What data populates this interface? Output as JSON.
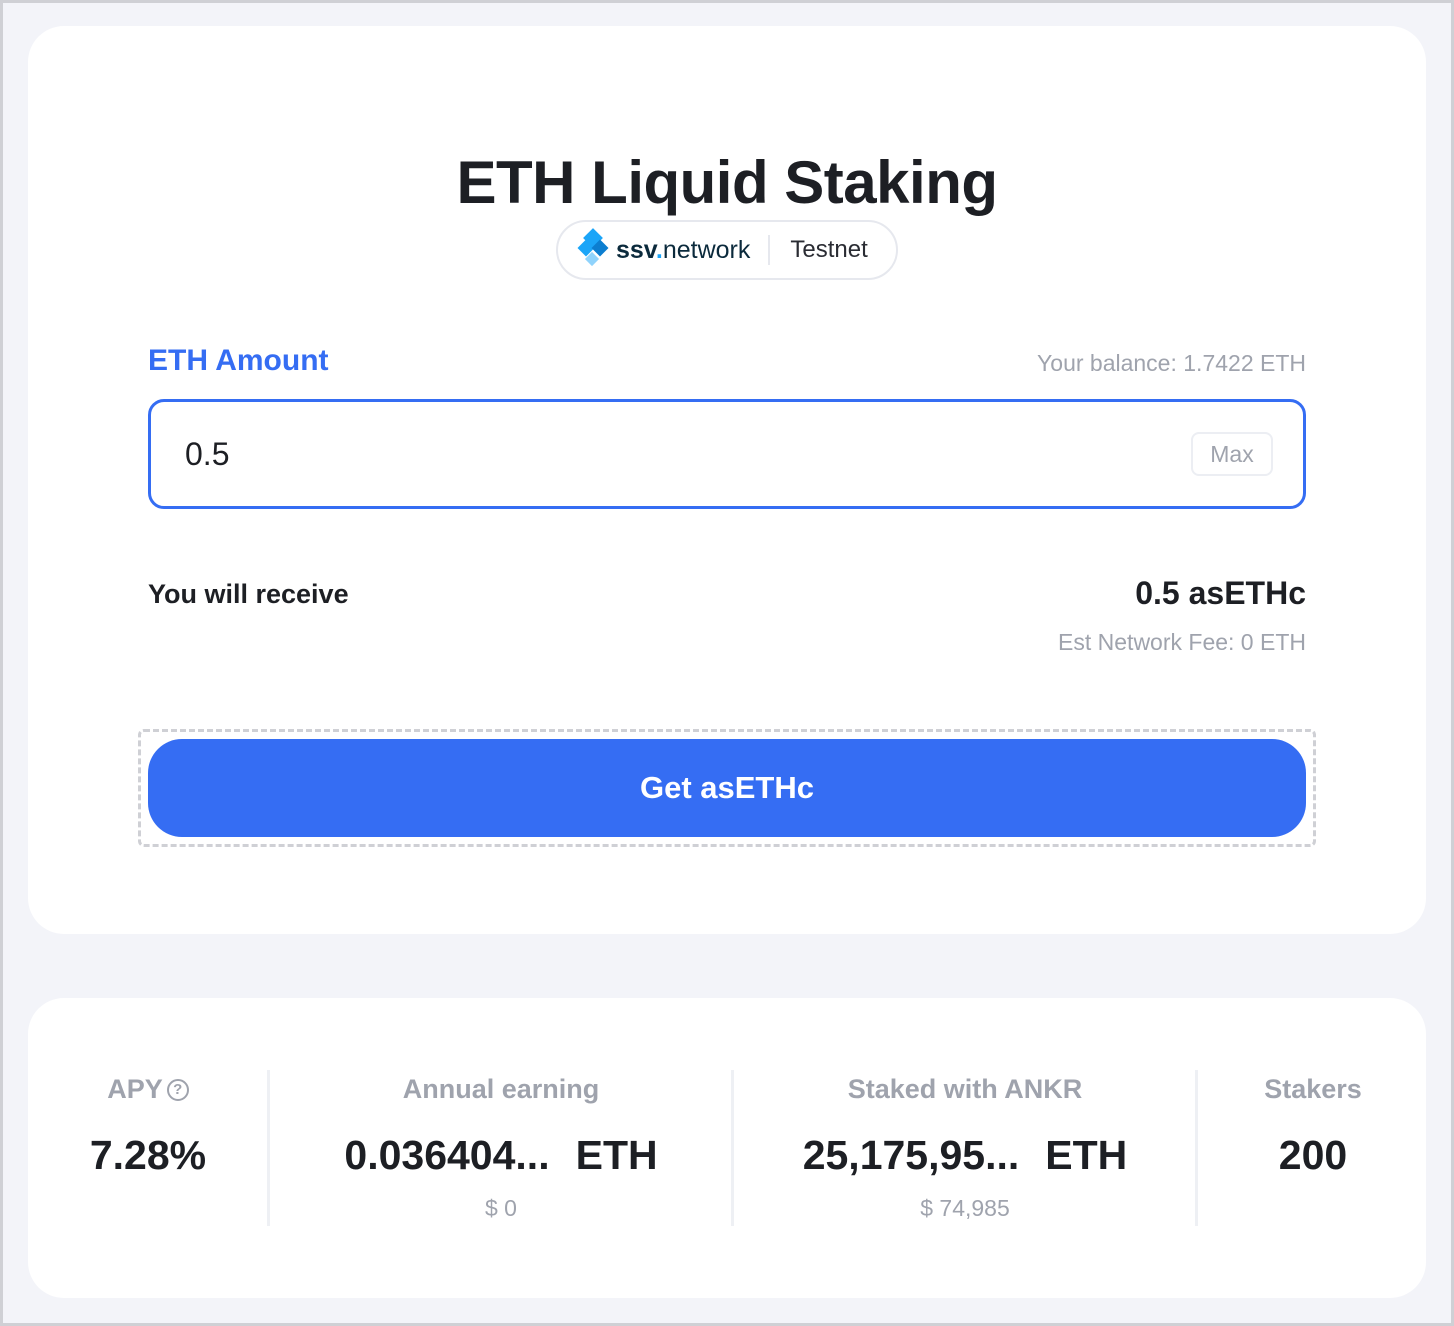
{
  "header": {
    "title": "ETH Liquid Staking",
    "network_brand": "ssv",
    "network_brand_dot": ".",
    "network_brand_suffix": "network",
    "network_name": "Testnet"
  },
  "form": {
    "amount_label": "ETH Amount",
    "balance_text": "Your balance: 1.7422 ETH",
    "amount_value": "0.5",
    "max_label": "Max",
    "receive_label": "You will receive",
    "receive_value": "0.5 asETHc",
    "fee_text": "Est Network Fee: 0 ETH",
    "submit_label": "Get asETHc"
  },
  "stats": {
    "apy": {
      "label": "APY",
      "value": "7.28%",
      "help_icon": "?"
    },
    "annual_earning": {
      "label": "Annual earning",
      "value": "0.036404...",
      "unit": "ETH",
      "usd": "$ 0"
    },
    "staked": {
      "label": "Staked with ANKR",
      "value": "25,175,95...",
      "unit": "ETH",
      "usd": "$ 74,985"
    },
    "stakers": {
      "label": "Stakers",
      "value": "200"
    }
  },
  "colors": {
    "accent": "#356df3",
    "muted": "#9fa3ad",
    "background": "#f3f4f9"
  },
  "icons": [
    "ssv-network-logo-icon",
    "help-circle-icon"
  ]
}
